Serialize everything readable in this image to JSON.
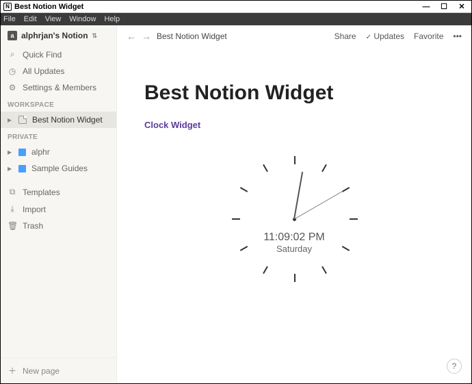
{
  "titlebar": {
    "app_icon": "N",
    "title": "Best Notion Widget"
  },
  "menubar": {
    "file": "File",
    "edit": "Edit",
    "view": "View",
    "window": "Window",
    "help": "Help"
  },
  "sidebar": {
    "workspace_name": "alphrjan's Notion",
    "quick_find": "Quick Find",
    "all_updates": "All Updates",
    "settings": "Settings & Members",
    "section_workspace": "WORKSPACE",
    "workspace_pages": [
      {
        "label": "Best Notion Widget"
      }
    ],
    "section_private": "PRIVATE",
    "private_pages": [
      {
        "label": "alphr"
      },
      {
        "label": "Sample Guides"
      }
    ],
    "templates": "Templates",
    "import": "Import",
    "trash": "Trash",
    "new_page": "New page"
  },
  "topbar": {
    "breadcrumb": "Best Notion Widget",
    "share": "Share",
    "updates": "Updates",
    "favorite": "Favorite"
  },
  "page": {
    "title": "Best Notion Widget",
    "link": "Clock Widget"
  },
  "clock": {
    "time": "11:09:02 PM",
    "day": "Saturday",
    "minute_angle": 10,
    "second_angle": 60
  },
  "help": "?"
}
